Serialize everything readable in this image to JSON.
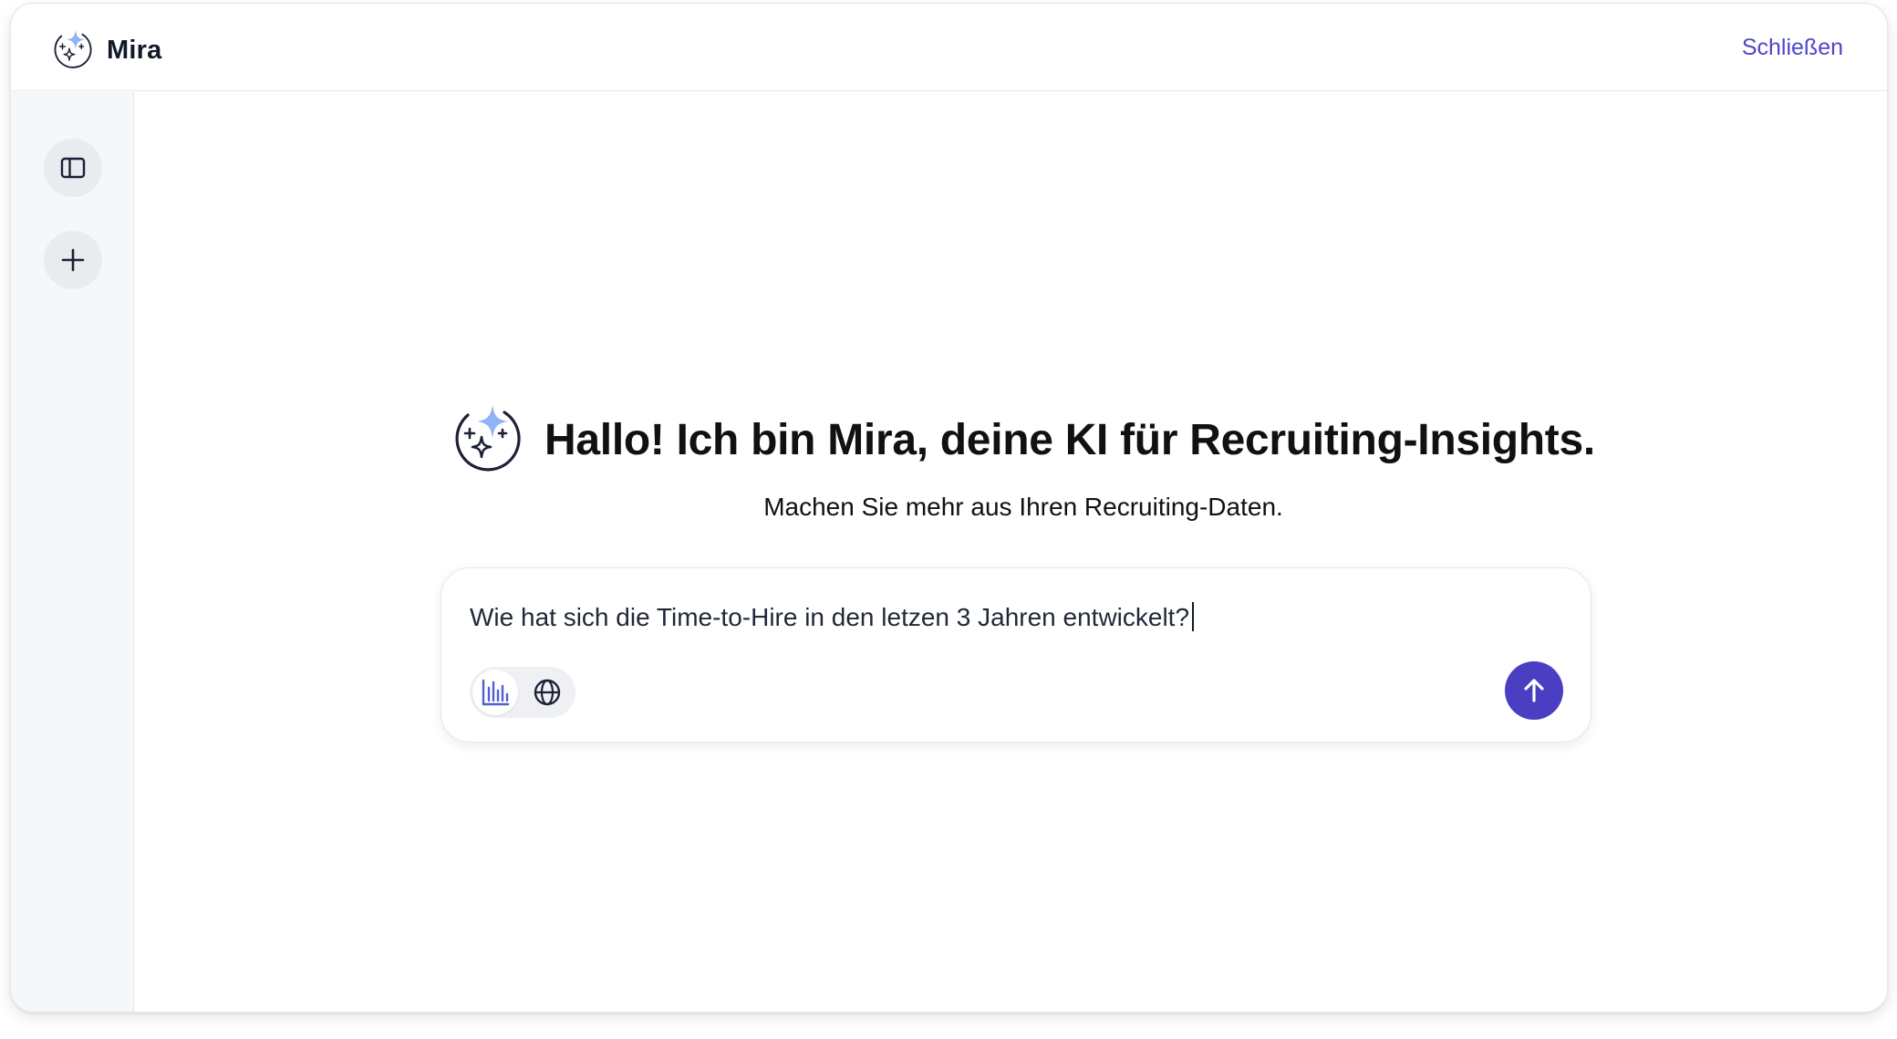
{
  "app": {
    "name": "Mira",
    "close_label": "Schließen"
  },
  "sidebar": {
    "toggle_icon": "sidebar-toggle-icon",
    "new_chat_icon": "plus-icon"
  },
  "welcome": {
    "title": "Hallo! Ich bin Mira, deine KI für Recruiting-Insights.",
    "subtitle": "Machen Sie mehr aus Ihren Recruiting-Daten."
  },
  "composer": {
    "value": "Wie hat sich die Time-to-Hire in den letzen 3 Jahren entwickelt?",
    "tools": [
      {
        "icon": "bar-chart-icon",
        "active": true
      },
      {
        "icon": "globe-icon",
        "active": false
      }
    ],
    "send_icon": "arrow-up-icon"
  },
  "colors": {
    "accent": "#4a3fc2",
    "link": "#4f46c6",
    "sparkle": "#8fb3f5",
    "ink": "#111827",
    "sidebar_bg": "#f6f7f9"
  }
}
